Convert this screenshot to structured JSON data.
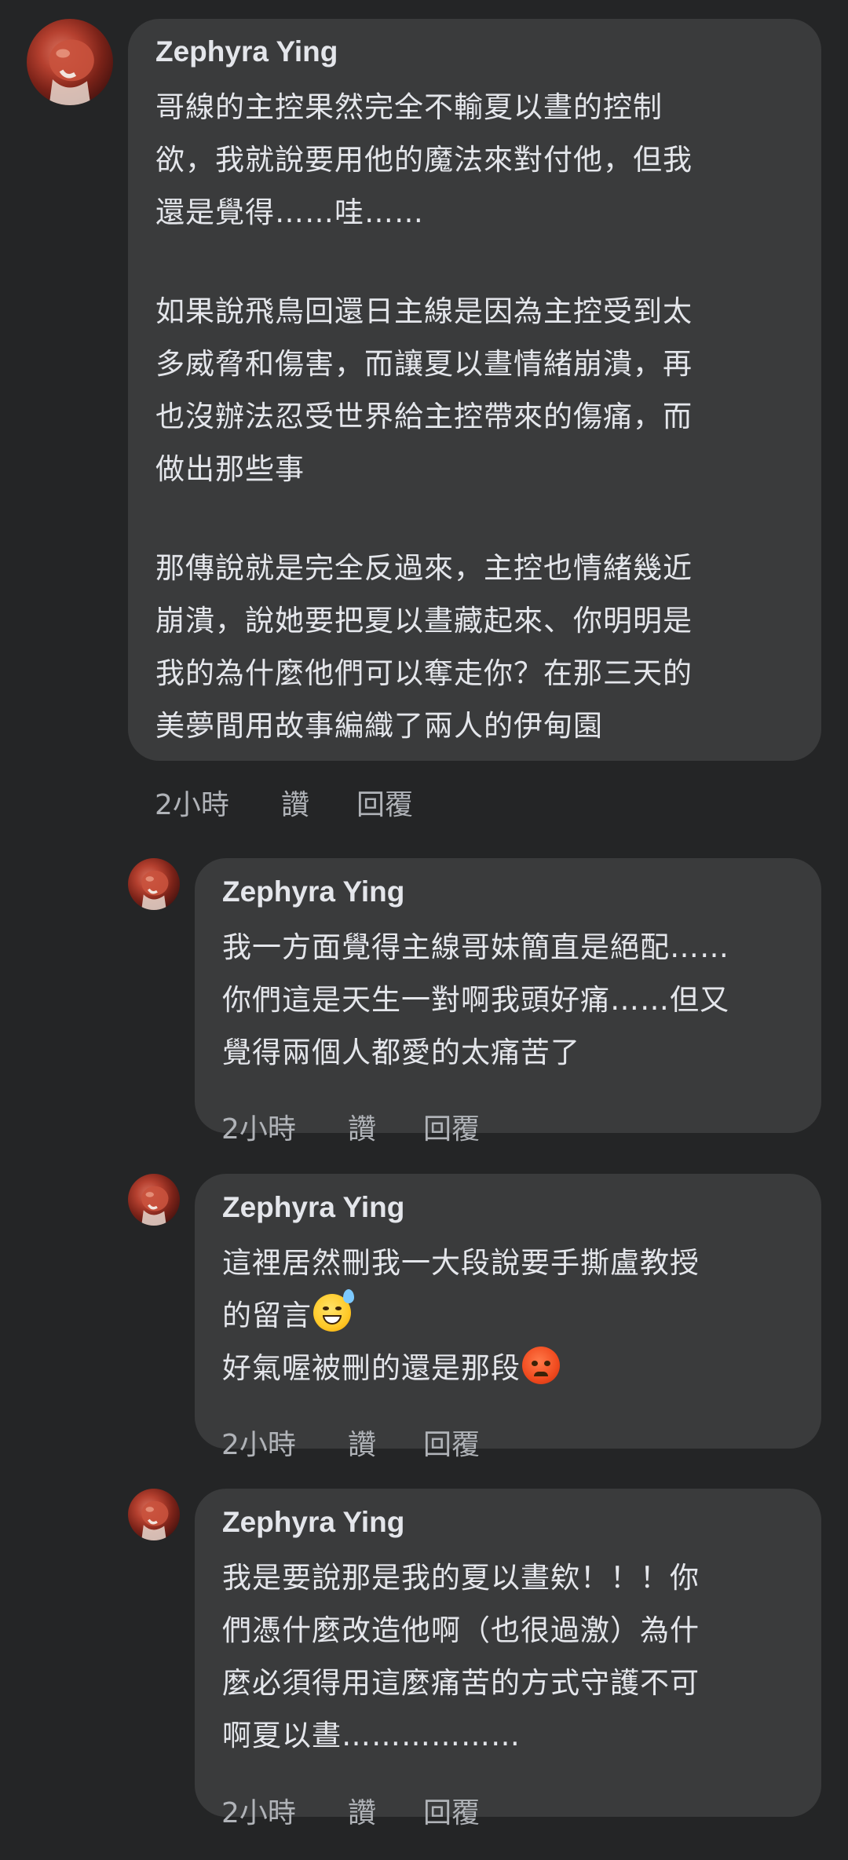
{
  "comments": [
    {
      "author": "Zephyra Ying",
      "lines": [
        "哥線的主控果然完全不輸夏以晝的控制",
        "欲，我就說要用他的魔法來對付他，但我",
        "還是覺得……哇……",
        "",
        "如果說飛鳥回還日主線是因為主控受到太",
        "多威脅和傷害，而讓夏以晝情緒崩潰，再",
        "也沒辦法忍受世界給主控帶來的傷痛，而",
        "做出那些事",
        "",
        "那傳說就是完全反過來，主控也情緒幾近",
        "崩潰，說她要把夏以晝藏起來、你明明是",
        "我的為什麼他們可以奪走你？在那三天的",
        "美夢間用故事編織了兩人的伊甸園"
      ],
      "time": "2小時",
      "like": "讚",
      "reply": "回覆"
    },
    {
      "author": "Zephyra Ying",
      "lines": [
        "我一方面覺得主線哥妹簡直是絕配……",
        "你們這是天生一對啊我頭好痛……但又",
        "覺得兩個人都愛的太痛苦了"
      ],
      "time": "2小時",
      "like": "讚",
      "reply": "回覆"
    },
    {
      "author": "Zephyra Ying",
      "lines": [
        "這裡居然刪我一大段說要手撕盧教授",
        "的留言",
        "好氣喔被刪的還是那段"
      ],
      "emoji_line2": "sweat-smile-emoji",
      "emoji_line3": "angry-face-emoji",
      "time": "2小時",
      "like": "讚",
      "reply": "回覆"
    },
    {
      "author": "Zephyra Ying",
      "lines": [
        "我是要說那是我的夏以晝欸！！！你",
        "們憑什麼改造他啊（也很過激）為什",
        "麼必須得用這麼痛苦的方式守護不可",
        "啊夏以晝………………"
      ],
      "time": "2小時",
      "like": "讚",
      "reply": "回覆"
    }
  ],
  "colors": {
    "background": "#242526",
    "bubble": "#3a3b3c",
    "text": "#e4e6eb",
    "meta": "#b0b3b8"
  }
}
